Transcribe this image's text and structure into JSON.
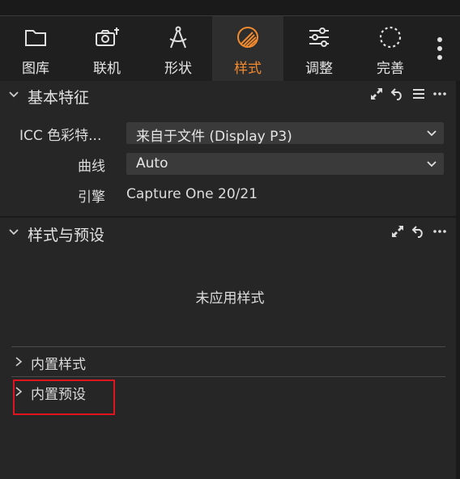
{
  "toolbar": {
    "tabs": [
      {
        "label": "图库",
        "icon": "folder-icon"
      },
      {
        "label": "联机",
        "icon": "camera-icon"
      },
      {
        "label": "形状",
        "icon": "compass-icon"
      },
      {
        "label": "样式",
        "icon": "style-icon",
        "active": true
      },
      {
        "label": "调整",
        "icon": "sliders-icon"
      },
      {
        "label": "完善",
        "icon": "refine-icon"
      }
    ],
    "more_icon": "vertical-ellipsis-icon"
  },
  "basic": {
    "title": "基本特征",
    "icc_label": "ICC 色彩特...",
    "icc_value": "来自于文件 (Display P3)",
    "curve_label": "曲线",
    "curve_value": "Auto",
    "engine_label": "引擎",
    "engine_value": "Capture One 20/21"
  },
  "styles": {
    "title": "样式与预设",
    "empty_text": "未应用样式",
    "builtin_styles": "内置样式",
    "builtin_presets": "内置预设"
  },
  "colors": {
    "accent": "#f28a2e",
    "highlight": "#e0141e",
    "background": "#262626"
  }
}
